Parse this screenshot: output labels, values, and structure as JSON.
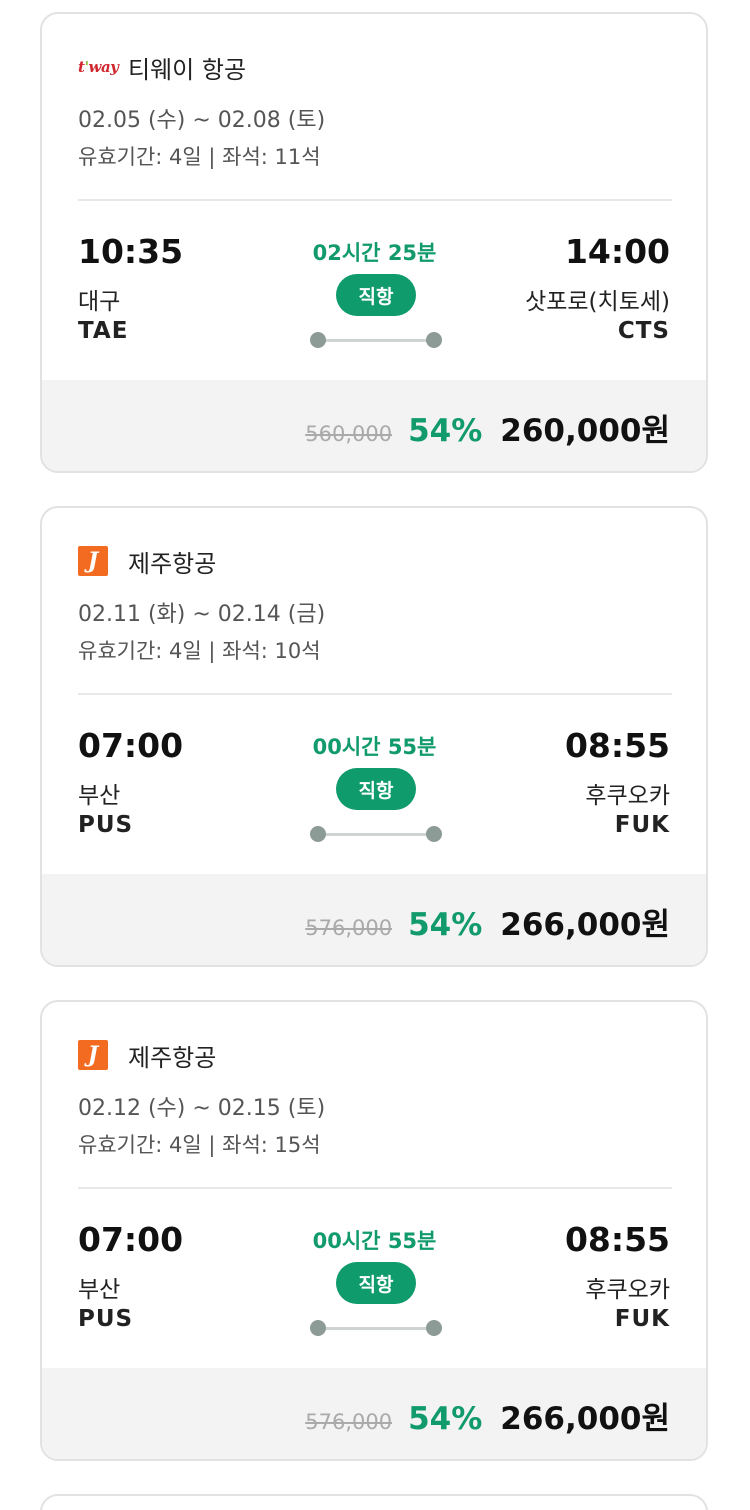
{
  "flights": [
    {
      "airline": {
        "name": "티웨이 항공",
        "logo_text": "t'way",
        "logo_icon": "tway-logo-icon"
      },
      "dates": "02.05 (수) ~ 02.08 (토)",
      "meta": "유효기간: 4일 | 좌석: 11석",
      "departure": {
        "time": "10:35",
        "city": "대구",
        "code": "TAE"
      },
      "arrival": {
        "time": "14:00",
        "city": "삿포로(치토세)",
        "code": "CTS"
      },
      "duration": "02시간 25분",
      "direct_label": "직항",
      "original_price": "560,000",
      "discount": "54%",
      "price": "260,000원"
    },
    {
      "airline": {
        "name": "제주항공",
        "logo_text": "J",
        "logo_icon": "jeju-air-logo-icon"
      },
      "dates": "02.11 (화) ~ 02.14 (금)",
      "meta": "유효기간: 4일 | 좌석: 10석",
      "departure": {
        "time": "07:00",
        "city": "부산",
        "code": "PUS"
      },
      "arrival": {
        "time": "08:55",
        "city": "후쿠오카",
        "code": "FUK"
      },
      "duration": "00시간 55분",
      "direct_label": "직항",
      "original_price": "576,000",
      "discount": "54%",
      "price": "266,000원"
    },
    {
      "airline": {
        "name": "제주항공",
        "logo_text": "J",
        "logo_icon": "jeju-air-logo-icon"
      },
      "dates": "02.12 (수) ~ 02.15 (토)",
      "meta": "유효기간: 4일 | 좌석: 15석",
      "departure": {
        "time": "07:00",
        "city": "부산",
        "code": "PUS"
      },
      "arrival": {
        "time": "08:55",
        "city": "후쿠오카",
        "code": "FUK"
      },
      "duration": "00시간 55분",
      "direct_label": "직항",
      "original_price": "576,000",
      "discount": "54%",
      "price": "266,000원"
    }
  ],
  "colors": {
    "accent_green": "#119a6b",
    "badge_green": "#0f9b6c",
    "tway_red": "#d0262d",
    "jeju_orange": "#f26b21",
    "price_bar_bg": "#f3f3f3"
  }
}
